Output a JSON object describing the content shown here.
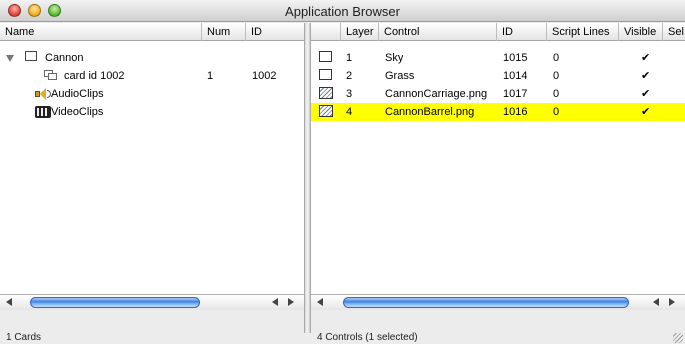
{
  "window": {
    "title": "Application Browser"
  },
  "left": {
    "columns": [
      "Name",
      "Num",
      "ID"
    ],
    "tree": {
      "stack": {
        "name": "Cannon"
      },
      "card": {
        "name": "card id 1002",
        "num": "1",
        "id": "1002"
      },
      "audio": {
        "name": "AudioClips"
      },
      "video": {
        "name": "VideoClips"
      }
    },
    "status": "1 Cards"
  },
  "right": {
    "columns": [
      "Layer",
      "Control",
      "ID",
      "Script Lines",
      "Visible",
      "Sel"
    ],
    "rows": [
      {
        "icon": "box-icon",
        "layer": "1",
        "control": "Sky",
        "id": "1015",
        "script_lines": "0",
        "visible": "✔",
        "selected": false
      },
      {
        "icon": "box-icon",
        "layer": "2",
        "control": "Grass",
        "id": "1014",
        "script_lines": "0",
        "visible": "✔",
        "selected": false
      },
      {
        "icon": "image-icon",
        "layer": "3",
        "control": "CannonCarriage.png",
        "id": "1017",
        "script_lines": "0",
        "visible": "✔",
        "selected": false
      },
      {
        "icon": "image-icon",
        "layer": "4",
        "control": "CannonBarrel.png",
        "id": "1016",
        "script_lines": "0",
        "visible": "✔",
        "selected": true
      }
    ],
    "status": "4 Controls (1 selected)"
  },
  "colors": {
    "selection": "#ffff00",
    "scroll_thumb": "#3b7fe0"
  }
}
